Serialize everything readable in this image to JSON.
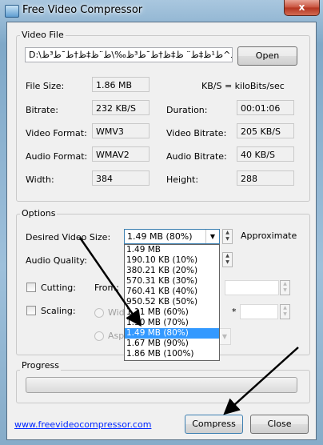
{
  "window": {
    "title": "Free Video Compressor",
    "close_glyph": "x"
  },
  "video_file": {
    "group_label": "Video File",
    "path": "D:\\آ¶_%ط¨ط¯ط±ط²ظ^ط¹ظ‡ط¨ ظ‡ظ†ط¯ط³ظ‰\\ط¨ظ‡ظ†ط¯ط³ظ‰.wmv",
    "open_label": "Open",
    "kbs_note": "KB/S = kiloBits/sec",
    "file_size_label": "File Size:",
    "file_size": "1.86 MB",
    "bitrate_label": "Bitrate:",
    "bitrate": "232 KB/S",
    "duration_label": "Duration:",
    "duration": "00:01:06",
    "video_format_label": "Video Format:",
    "video_format": "WMV3",
    "video_bitrate_label": "Video Bitrate:",
    "video_bitrate": "205 KB/S",
    "audio_format_label": "Audio Format:",
    "audio_format": "WMAV2",
    "audio_bitrate_label": "Audio Bitrate:",
    "audio_bitrate": "40 KB/S",
    "width_label": "Width:",
    "width": "384",
    "height_label": "Height:",
    "height": "288"
  },
  "options": {
    "group_label": "Options",
    "desired_size_label": "Desired Video Size:",
    "desired_size_value": "1.49 MB (80%)",
    "approximate_label": "Approximate",
    "audio_quality_label": "Audio Quality:",
    "cutting_label": "Cutting:",
    "from_label": "From:",
    "scaling_label": "Scaling:",
    "width_radio_label": "Wid",
    "aspect_radio_label": "Asp",
    "times_glyph": "*",
    "dropdown_items": [
      "1.49 MB",
      "190.10 KB (10%)",
      "380.21 KB (20%)",
      "570.31 KB (30%)",
      "760.41 KB (40%)",
      "950.52 KB (50%)",
      "1.11 MB (60%)",
      "1.30 MB (70%)",
      "1.49 MB (80%)",
      "1.67 MB (90%)",
      "1.86 MB (100%)"
    ],
    "dropdown_selected_index": 8
  },
  "progress": {
    "group_label": "Progress",
    "value": 0
  },
  "footer": {
    "link": "www.freevideocompressor.com",
    "compress_label": "Compress",
    "close_label": "Close"
  }
}
